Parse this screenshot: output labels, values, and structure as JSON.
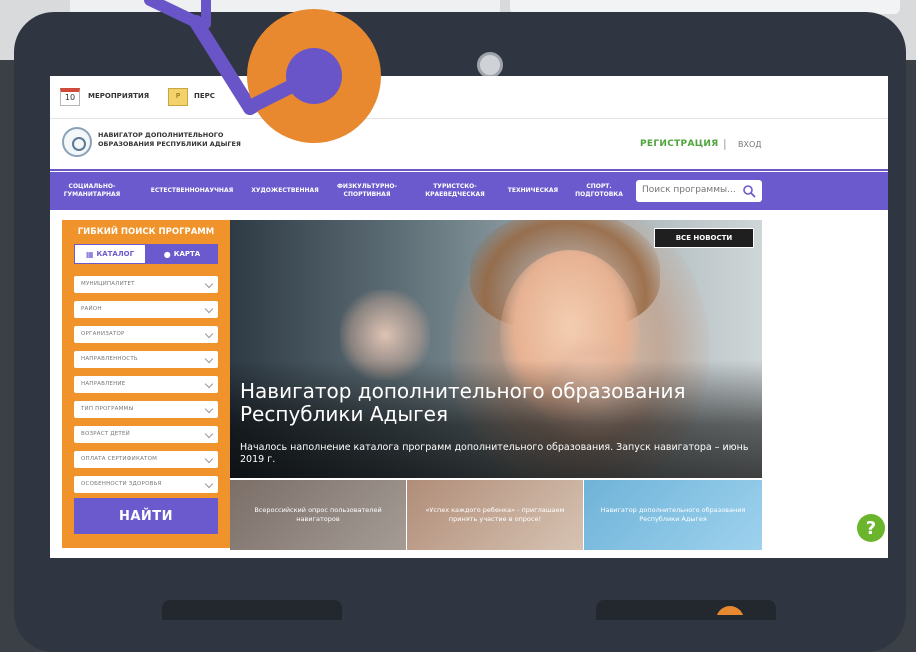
{
  "topbar": {
    "events_label": "МЕРОПРИЯТИЯ",
    "calendar_day": "10",
    "personal_label": "ПЕРС"
  },
  "header": {
    "logo_text": "НАВИГАТОР ДОПОЛНИТЕЛЬНОГО ОБРАЗОВАНИЯ РЕСПУБЛИКИ АДЫГЕЯ",
    "register": "РЕГИСТРАЦИЯ",
    "separator": "|",
    "login": "ВХОД"
  },
  "nav": {
    "items": [
      "СОЦИАЛЬНО-ГУМАНИТАРНАЯ",
      "ЕСТЕСТВЕННОНАУЧНАЯ",
      "ХУДОЖЕСТВЕННАЯ",
      "ФИЗКУЛЬТУРНО-СПОРТИВНАЯ",
      "ТУРИСТСКО-КРАЕВЕДЧЕСКАЯ",
      "ТЕХНИЧЕСКАЯ",
      "СПОРТ. ПОДГОТОВКА"
    ],
    "search_placeholder": "Поиск программы..."
  },
  "filter_panel": {
    "title": "ГИБКИЙ ПОИСК ПРОГРАММ",
    "tab_catalog": "КАТАЛОГ",
    "tab_map": "КАРТА",
    "filters": [
      "МУНИЦИПАЛИТЕТ",
      "РАЙОН",
      "ОРГАНИЗАТОР",
      "НАПРАВЛЕННОСТЬ",
      "НАПРАВЛЕНИЕ",
      "ТИП ПРОГРАММЫ",
      "ВОЗРАСТ ДЕТЕЙ",
      "ОПЛАТА СЕРТИФИКАТОМ",
      "ОСОБЕННОСТИ ЗДОРОВЬЯ"
    ],
    "find_button": "НАЙТИ"
  },
  "hero": {
    "all_news": "ВСЕ НОВОСТИ",
    "title": "Навигатор дополнительного образования Республики Адыгея",
    "subtitle": "Началось наполнение каталога программ дополнительного образования. Запуск навигатора – июнь 2019 г."
  },
  "cards": [
    "Всероссийский опрос пользователей навигаторов",
    "«Успех каждого ребенка» - приглашаем принять участие в опросе!",
    "Навигатор дополнительного образования Республики Адыгея"
  ],
  "help": {
    "label": "?"
  },
  "colors": {
    "purple": "#6a5acd",
    "orange": "#f0932b",
    "green": "#4ea43c",
    "deco_orange": "#e8892f",
    "deco_purple": "#6a55c8"
  }
}
